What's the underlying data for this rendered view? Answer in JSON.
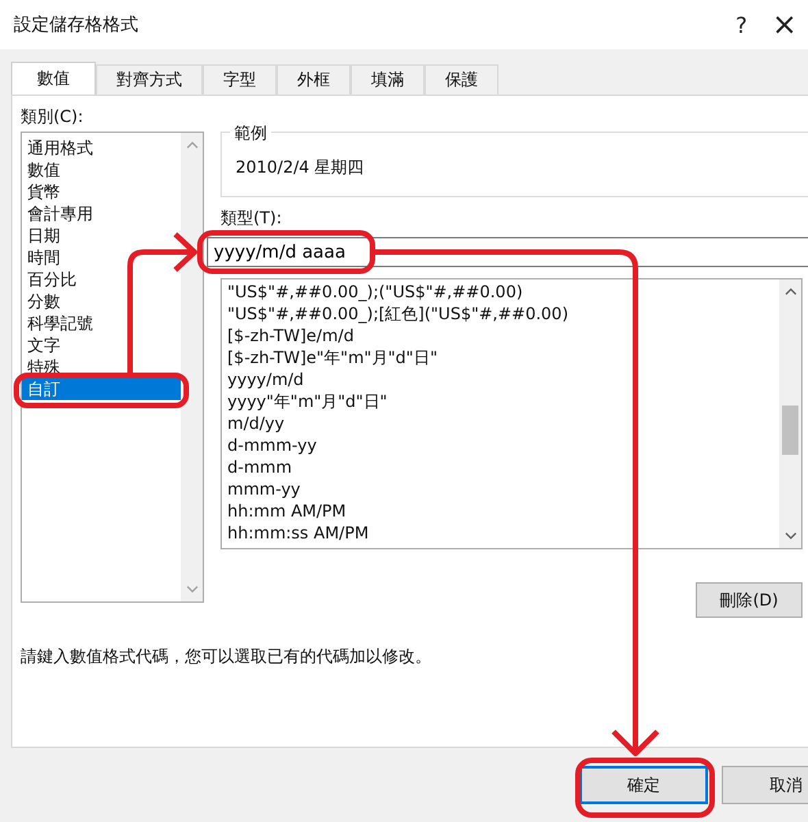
{
  "window": {
    "title": "設定儲存格格式",
    "help": "?",
    "close": "×"
  },
  "tabs": [
    {
      "label": "數值",
      "selected": true
    },
    {
      "label": "對齊方式",
      "selected": false
    },
    {
      "label": "字型",
      "selected": false
    },
    {
      "label": "外框",
      "selected": false
    },
    {
      "label": "填滿",
      "selected": false
    },
    {
      "label": "保護",
      "selected": false
    }
  ],
  "category": {
    "label": "類別(C):",
    "items": [
      {
        "label": "通用格式",
        "selected": false
      },
      {
        "label": "數值",
        "selected": false
      },
      {
        "label": "貨幣",
        "selected": false
      },
      {
        "label": "會計專用",
        "selected": false
      },
      {
        "label": "日期",
        "selected": false
      },
      {
        "label": "時間",
        "selected": false
      },
      {
        "label": "百分比",
        "selected": false
      },
      {
        "label": "分數",
        "selected": false
      },
      {
        "label": "科學記號",
        "selected": false
      },
      {
        "label": "文字",
        "selected": false
      },
      {
        "label": "特殊",
        "selected": false
      },
      {
        "label": "自訂",
        "selected": true
      }
    ]
  },
  "sample": {
    "label": "範例",
    "value": "2010/2/4 星期四"
  },
  "type": {
    "label": "類型(T):",
    "value": "yyyy/m/d aaaa",
    "formats": [
      "\"US$\"#,##0.00_);(\"US$\"#,##0.00)",
      "\"US$\"#,##0.00_);[紅色](\"US$\"#,##0.00)",
      "[$-zh-TW]e/m/d",
      "[$-zh-TW]e\"年\"m\"月\"d\"日\"",
      "yyyy/m/d",
      "yyyy\"年\"m\"月\"d\"日\"",
      "m/d/yy",
      "d-mmm-yy",
      "d-mmm",
      "mmm-yy",
      "hh:mm AM/PM",
      "hh:mm:ss AM/PM"
    ]
  },
  "delete_button": "刪除(D)",
  "hint": "請鍵入數值格式代碼，您可以選取已有的代碼加以修改。",
  "buttons": [
    {
      "label": "確定",
      "kind": "primary"
    },
    {
      "label": "取消",
      "kind": "normal"
    }
  ]
}
